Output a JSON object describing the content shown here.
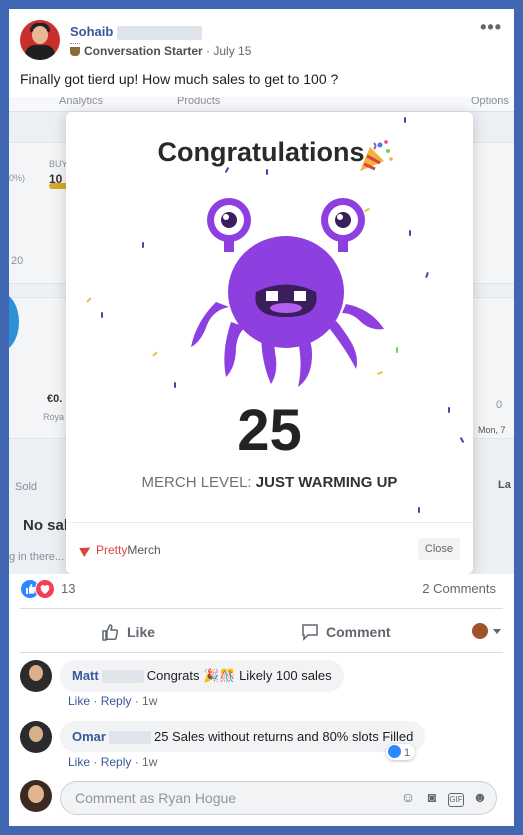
{
  "post": {
    "author": "Sohaib",
    "badge": "Conversation Starter",
    "date": "July 15",
    "text": "Finally got tierd up! How much sales to get to 100 ?",
    "more_icon": "•••"
  },
  "background_app": {
    "tabs": [
      "Analytics",
      "Products",
      "Options"
    ],
    "fragments": [
      "BUY",
      "10",
      "0%)",
      "20",
      "€0.",
      "Roya",
      "0",
      "Mon, 7",
      "Sold",
      "No sal",
      "g in there...",
      "La"
    ]
  },
  "modal": {
    "title": "Congratulations",
    "score": "25",
    "level_label": "MERCH LEVEL:",
    "level_value": "JUST WARMING UP",
    "brand_pretty": "Pretty",
    "brand_merch": "Merch",
    "close_label": "Close"
  },
  "reactions": {
    "count": "13",
    "comments": "2 Comments"
  },
  "actions": {
    "like": "Like",
    "comment": "Comment"
  },
  "comments": [
    {
      "name": "Matt",
      "text_before": "Congrats ",
      "emojis": "🎉🎊",
      "text_after": " Likely 100 sales",
      "like": "Like",
      "reply": "Reply",
      "age": "1w"
    },
    {
      "name": "Omar",
      "text_before": "25 Sales without returns and 80% slots Filled",
      "like": "Like",
      "reply": "Reply",
      "age": "1w",
      "likes": "1"
    }
  ],
  "composer": {
    "placeholder": "Comment as Ryan Hogue"
  },
  "colors": {
    "frame": "#4267b2",
    "link": "#385898",
    "monster": "#8e3fe0",
    "accent_red": "#d9453b"
  }
}
